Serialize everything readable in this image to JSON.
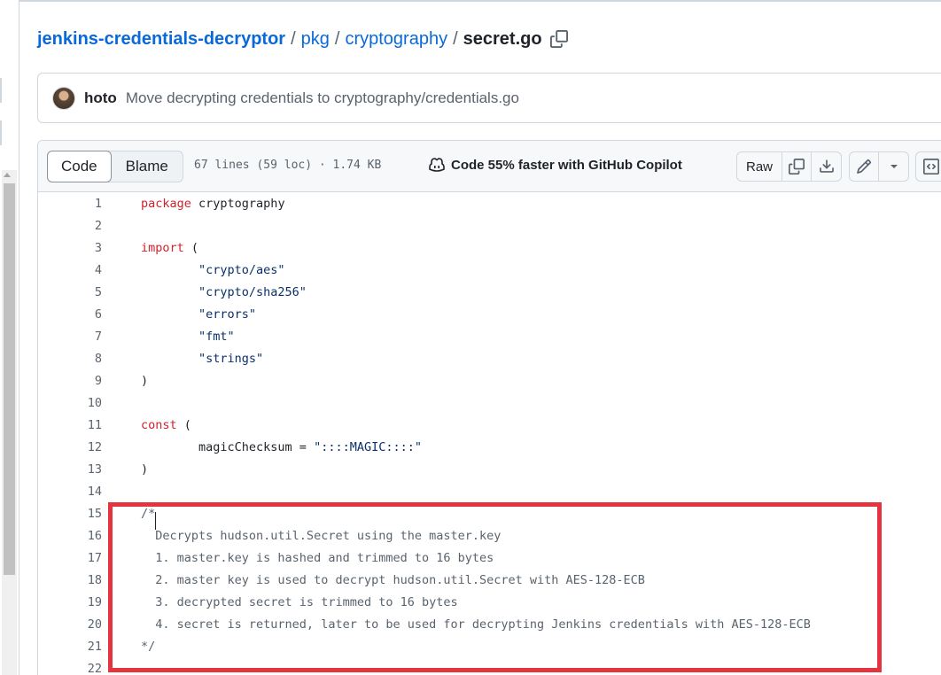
{
  "breadcrumb": {
    "repo": "jenkins-credentials-decryptor",
    "sep1": "/",
    "dir1": "pkg",
    "sep2": "/",
    "dir2": "cryptography",
    "sep3": "/",
    "file": "secret.go"
  },
  "commit": {
    "author": "hoto",
    "message": "Move decrypting credentials to cryptography/credentials.go"
  },
  "file_header": {
    "tabs": [
      {
        "label": "Code",
        "active": true
      },
      {
        "label": "Blame",
        "active": false
      }
    ],
    "meta": "67 lines (59 loc) · 1.74 KB",
    "copilot": "Code 55% faster with GitHub Copilot",
    "raw_label": "Raw"
  },
  "code_lines": [
    {
      "n": "1",
      "text": "package cryptography"
    },
    {
      "n": "2",
      "text": ""
    },
    {
      "n": "3",
      "text": "import ("
    },
    {
      "n": "4",
      "text": "        \"crypto/aes\""
    },
    {
      "n": "5",
      "text": "        \"crypto/sha256\""
    },
    {
      "n": "6",
      "text": "        \"errors\""
    },
    {
      "n": "7",
      "text": "        \"fmt\""
    },
    {
      "n": "8",
      "text": "        \"strings\""
    },
    {
      "n": "9",
      "text": ")"
    },
    {
      "n": "10",
      "text": ""
    },
    {
      "n": "11",
      "text": "const ("
    },
    {
      "n": "12",
      "text": "        magicChecksum = \"::::MAGIC::::\""
    },
    {
      "n": "13",
      "text": ")"
    },
    {
      "n": "14",
      "text": ""
    },
    {
      "n": "15",
      "text": "/*"
    },
    {
      "n": "16",
      "text": "  Decrypts hudson.util.Secret using the master.key"
    },
    {
      "n": "17",
      "text": "  1. master.key is hashed and trimmed to 16 bytes"
    },
    {
      "n": "18",
      "text": "  2. master key is used to decrypt hudson.util.Secret with AES-128-ECB"
    },
    {
      "n": "19",
      "text": "  3. decrypted secret is trimmed to 16 bytes"
    },
    {
      "n": "20",
      "text": "  4. secret is returned, later to be used for decrypting Jenkins credentials with AES-128-ECB"
    },
    {
      "n": "21",
      "text": "*/"
    },
    {
      "n": "22",
      "text": ""
    }
  ],
  "colors": {
    "link": "#0969da",
    "keyword": "#cf222e",
    "string": "#0a3069",
    "highlight": "#e5343d"
  },
  "icons": [
    "copy-icon",
    "copilot-icon",
    "download-icon",
    "pencil-icon",
    "chevron-down-icon",
    "code-square-icon"
  ]
}
